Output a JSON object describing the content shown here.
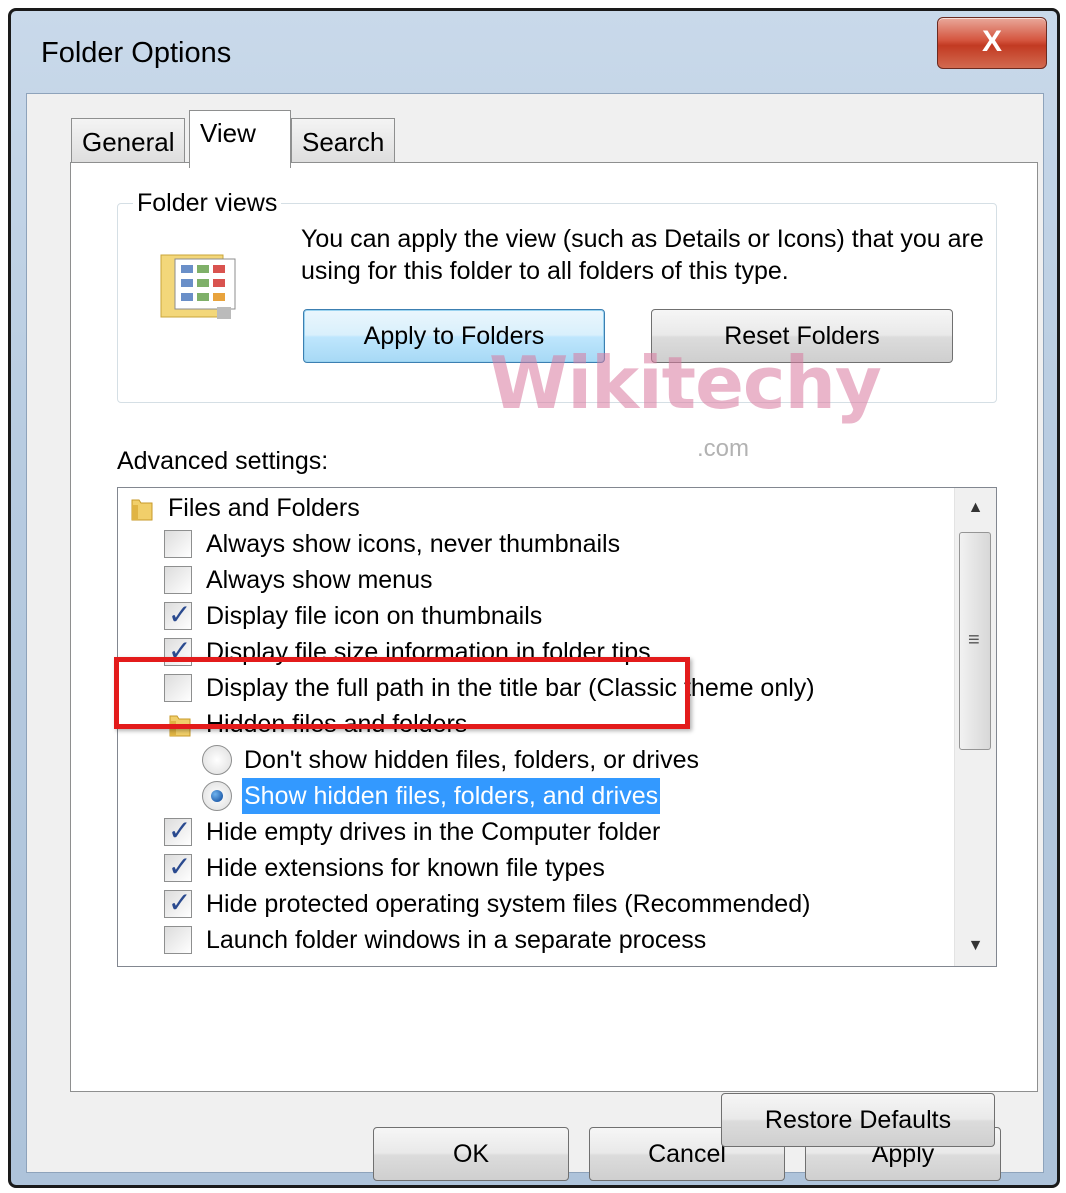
{
  "window": {
    "title": "Folder Options",
    "close_label": "X"
  },
  "tabs": [
    {
      "label": "General"
    },
    {
      "label": "View"
    },
    {
      "label": "Search"
    }
  ],
  "folder_views": {
    "group_title": "Folder views",
    "description": "You can apply the view (such as Details or Icons) that you are using for this folder to all folders of this type.",
    "apply_button": "Apply to Folders",
    "reset_button": "Reset Folders"
  },
  "watermark": {
    "text": "Wikitechy",
    "sub": ".com"
  },
  "advanced": {
    "label": "Advanced settings:",
    "items": [
      {
        "kind": "folder",
        "label": "Files and Folders"
      },
      {
        "kind": "checkbox",
        "checked": false,
        "label": "Always show icons, never thumbnails"
      },
      {
        "kind": "checkbox",
        "checked": false,
        "label": "Always show menus"
      },
      {
        "kind": "checkbox",
        "checked": true,
        "label": "Display file icon on thumbnails"
      },
      {
        "kind": "checkbox",
        "checked": true,
        "label": "Display file size information in folder tips"
      },
      {
        "kind": "checkbox",
        "checked": false,
        "label": "Display the full path in the title bar (Classic theme only)"
      },
      {
        "kind": "folder",
        "label": "Hidden files and folders"
      },
      {
        "kind": "radio",
        "checked": false,
        "label": "Don't show hidden files, folders, or drives"
      },
      {
        "kind": "radio",
        "checked": true,
        "selected": true,
        "label": "Show hidden files, folders, and drives"
      },
      {
        "kind": "checkbox",
        "checked": true,
        "label": "Hide empty drives in the Computer folder"
      },
      {
        "kind": "checkbox",
        "checked": true,
        "label": "Hide extensions for known file types"
      },
      {
        "kind": "checkbox",
        "checked": true,
        "label": "Hide protected operating system files (Recommended)"
      },
      {
        "kind": "checkbox",
        "checked": false,
        "label": "Launch folder windows in a separate process"
      }
    ],
    "restore_button": "Restore Defaults"
  },
  "footer": {
    "ok": "OK",
    "cancel": "Cancel",
    "apply": "Apply"
  },
  "colors": {
    "highlight_box": "#e31b1b",
    "selection": "#3399ff"
  }
}
